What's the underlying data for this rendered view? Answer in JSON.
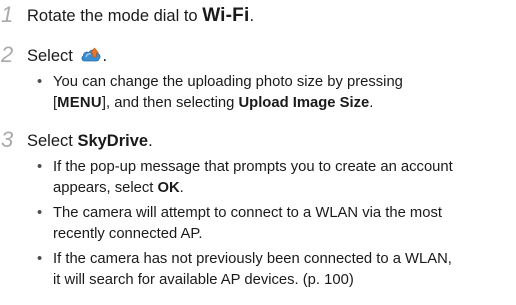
{
  "steps": [
    {
      "number": "1",
      "text_before": "Rotate the mode dial to ",
      "emphasis": "Wi-Fi",
      "text_after": "."
    },
    {
      "number": "2",
      "text_before": "Select ",
      "icon": "cloud-upload-icon",
      "text_after": ".",
      "bullets": [
        {
          "line1": "You can change the uploading photo size by pressing",
          "bracket_open": "[",
          "menu_key": "MENU",
          "bracket_close": "], and then selecting ",
          "bold_term": "Upload Image Size",
          "end": "."
        }
      ]
    },
    {
      "number": "3",
      "text_before": "Select ",
      "emphasis": "SkyDrive",
      "text_after": ".",
      "bullets": [
        {
          "line1": "If the pop-up message that prompts you to create an account",
          "line2_before": "appears, select ",
          "bold_term": "OK",
          "end": "."
        },
        {
          "line1": "The camera will attempt to connect to a WLAN via the most",
          "line2": "recently connected AP."
        },
        {
          "line1": "If the camera has not previously been connected to a WLAN,",
          "line2": "it will search for available AP devices. (p. 100)"
        }
      ]
    }
  ],
  "bullet_glyph": "•",
  "colors": {
    "step_number": "#a7a9ac",
    "text": "#1a1a1a",
    "icon_cloud": "#3b8fd1",
    "icon_arrow": "#e8732a"
  }
}
